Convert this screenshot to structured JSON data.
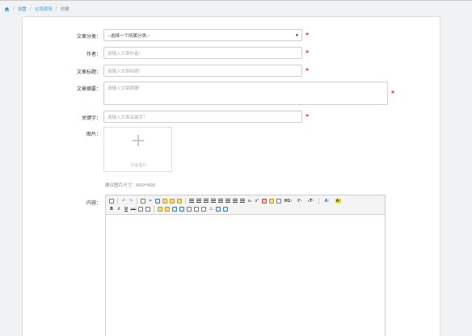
{
  "breadcrumb": {
    "items": [
      "设置",
      "公司资讯"
    ],
    "current": "创建"
  },
  "form": {
    "category": {
      "label": "文章分类：",
      "value": "--选择一个所属分类--"
    },
    "author": {
      "label": "作者：",
      "placeholder": "请输入文章作者！"
    },
    "title": {
      "label": "文章标题：",
      "placeholder": "请输入文章标题！"
    },
    "summary": {
      "label": "文章摘要：",
      "placeholder": "请输入文章摘要！"
    },
    "keywords": {
      "label": "关键字：",
      "placeholder": "请输入文章关键字！"
    },
    "image": {
      "label": "图片：",
      "upload_caption": "封面图片",
      "hint": "建议图片尺寸：600*400"
    },
    "content": {
      "label": "内容："
    },
    "required_mark": "*"
  },
  "editor": {
    "toolbar_text": {
      "h1": "H1·",
      "font": "ℱ·",
      "size": "ₜT·",
      "font_color": "A·",
      "highlight": "A·",
      "bold": "B",
      "italic": "I",
      "underline": "U",
      "strike": "ABC"
    }
  },
  "colors": {
    "required": "#e02b2b",
    "link": "#2f8ed6",
    "highlight": "#ffe600"
  }
}
